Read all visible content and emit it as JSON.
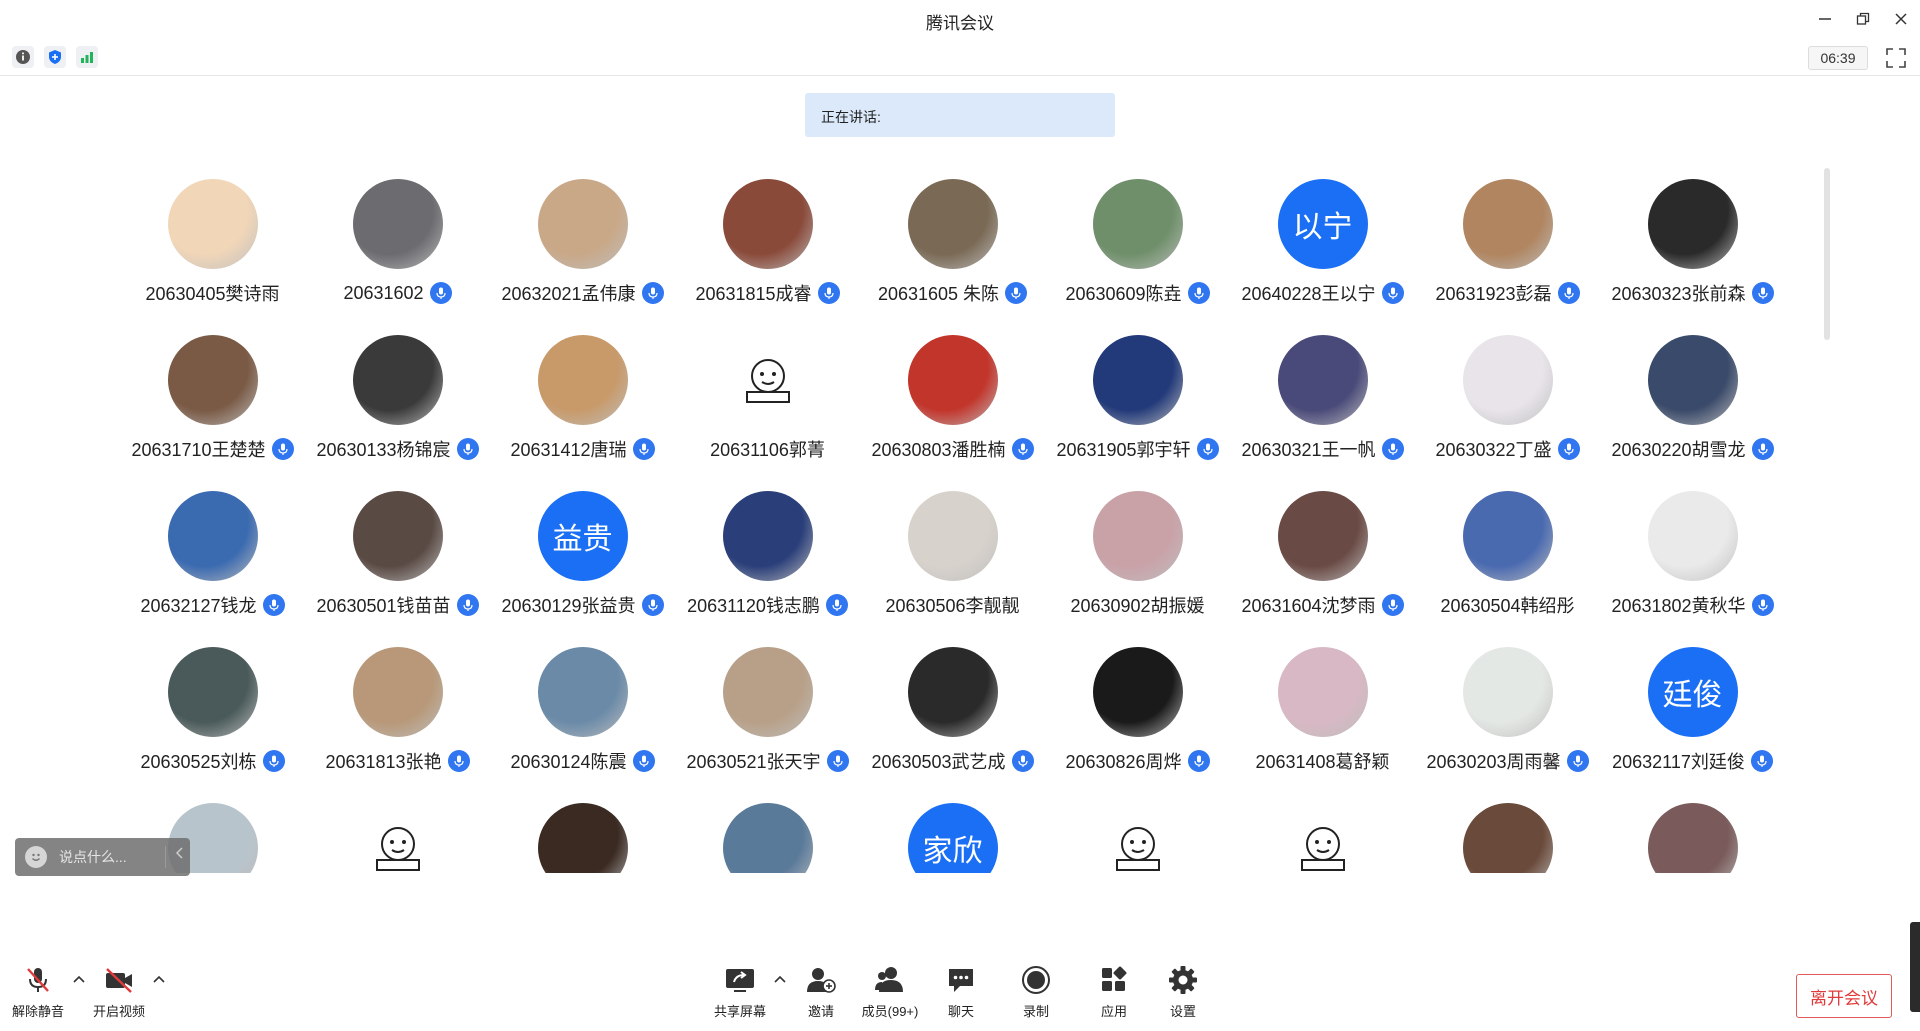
{
  "window": {
    "title": "腾讯会议"
  },
  "infobar": {
    "timer": "06:39"
  },
  "speaking": {
    "label": "正在讲话:"
  },
  "participants": [
    {
      "name": "20630405樊诗雨",
      "mic": false,
      "avatar": "photo",
      "color": "#f1d6b8"
    },
    {
      "name": "20631602",
      "mic": true,
      "avatar": "photo",
      "color": "#6b6b70"
    },
    {
      "name": "20632021孟伟康",
      "mic": true,
      "avatar": "photo",
      "color": "#c9a888"
    },
    {
      "name": "20631815成睿",
      "mic": true,
      "avatar": "photo",
      "color": "#8a4a3a"
    },
    {
      "name": "20631605 朱陈",
      "mic": true,
      "avatar": "photo",
      "color": "#7a6a55"
    },
    {
      "name": "20630609陈垚",
      "mic": true,
      "avatar": "photo",
      "color": "#6f8f6a"
    },
    {
      "name": "20640228王以宁",
      "mic": true,
      "avatar": "text",
      "text": "以宁"
    },
    {
      "name": "20631923彭磊",
      "mic": true,
      "avatar": "photo",
      "color": "#b08560"
    },
    {
      "name": "20630323张前森",
      "mic": true,
      "avatar": "photo",
      "color": "#2a2a2a"
    },
    {
      "name": "20631710王楚楚",
      "mic": true,
      "avatar": "photo",
      "color": "#7a5a45"
    },
    {
      "name": "20630133杨锦宸",
      "mic": true,
      "avatar": "photo",
      "color": "#3a3a3a"
    },
    {
      "name": "20631412唐瑞",
      "mic": true,
      "avatar": "photo",
      "color": "#c89a6a"
    },
    {
      "name": "20631106郭菁",
      "mic": false,
      "avatar": "sticker",
      "color": "#ffffff"
    },
    {
      "name": "20630803潘胜楠",
      "mic": true,
      "avatar": "photo",
      "color": "#c2352b"
    },
    {
      "name": "20631905郭宇轩",
      "mic": true,
      "avatar": "photo",
      "color": "#223a7a"
    },
    {
      "name": "20630321王一帆",
      "mic": true,
      "avatar": "photo",
      "color": "#4a4a7a"
    },
    {
      "name": "20630322丁盛",
      "mic": true,
      "avatar": "photo",
      "color": "#e8e4ea"
    },
    {
      "name": "20630220胡雪龙",
      "mic": true,
      "avatar": "photo",
      "color": "#3a4a6a"
    },
    {
      "name": "20632127钱龙",
      "mic": true,
      "avatar": "photo",
      "color": "#3a6ab0"
    },
    {
      "name": "20630501钱苗苗",
      "mic": true,
      "avatar": "photo",
      "color": "#5a4a44"
    },
    {
      "name": "20630129张益贵",
      "mic": true,
      "avatar": "text",
      "text": "益贵"
    },
    {
      "name": "20631120钱志鹏",
      "mic": true,
      "avatar": "photo",
      "color": "#2a3f7a"
    },
    {
      "name": "20630506李靓靓",
      "mic": false,
      "avatar": "photo",
      "color": "#d8d2cc"
    },
    {
      "name": "20630902胡振媛",
      "mic": false,
      "avatar": "photo",
      "color": "#c9a2a8"
    },
    {
      "name": "20631604沈梦雨",
      "mic": true,
      "avatar": "photo",
      "color": "#6a4a44"
    },
    {
      "name": "20630504韩绍彤",
      "mic": false,
      "avatar": "photo",
      "color": "#4a6ab0"
    },
    {
      "name": "20631802黄秋华",
      "mic": true,
      "avatar": "photo",
      "color": "#eaeaea"
    },
    {
      "name": "20630525刘栋",
      "mic": true,
      "avatar": "photo",
      "color": "#4a5a5a"
    },
    {
      "name": "20631813张艳",
      "mic": true,
      "avatar": "photo",
      "color": "#b89878"
    },
    {
      "name": "20630124陈震",
      "mic": true,
      "avatar": "photo",
      "color": "#6a8aa8"
    },
    {
      "name": "20630521张天宇",
      "mic": true,
      "avatar": "photo",
      "color": "#b8a088"
    },
    {
      "name": "20630503武艺成",
      "mic": true,
      "avatar": "photo",
      "color": "#2a2a2a"
    },
    {
      "name": "20630826周烨",
      "mic": true,
      "avatar": "photo",
      "color": "#1a1a1a"
    },
    {
      "name": "20631408葛舒颖",
      "mic": false,
      "avatar": "photo",
      "color": "#d8b8c4"
    },
    {
      "name": "20630203周雨馨",
      "mic": true,
      "avatar": "photo",
      "color": "#e4e8e4"
    },
    {
      "name": "20632117刘廷俊",
      "mic": true,
      "avatar": "text",
      "text": "廷俊"
    },
    {
      "name": "",
      "mic": false,
      "avatar": "photo",
      "color": "#b8c4cc"
    },
    {
      "name": "",
      "mic": false,
      "avatar": "sticker",
      "color": "#ffffff"
    },
    {
      "name": "",
      "mic": false,
      "avatar": "photo",
      "color": "#3a2a22"
    },
    {
      "name": "",
      "mic": false,
      "avatar": "photo",
      "color": "#5a7a9a"
    },
    {
      "name": "",
      "mic": false,
      "avatar": "text",
      "text": "家欣"
    },
    {
      "name": "",
      "mic": false,
      "avatar": "sticker",
      "color": "#ffffff"
    },
    {
      "name": "",
      "mic": false,
      "avatar": "sticker",
      "color": "#ffffff"
    },
    {
      "name": "",
      "mic": false,
      "avatar": "photo",
      "color": "#6a4a3a"
    },
    {
      "name": "",
      "mic": false,
      "avatar": "photo",
      "color": "#7a5a5a"
    }
  ],
  "chat": {
    "placeholder": "说点什么..."
  },
  "toolbar": {
    "unmute": "解除静音",
    "start_video": "开启视频",
    "share_screen": "共享屏幕",
    "invite": "邀请",
    "members": "成员(99+)",
    "chat": "聊天",
    "record": "录制",
    "apps": "应用",
    "settings": "设置",
    "leave": "离开会议"
  },
  "colors": {
    "accent": "#1a6ff5",
    "leave": "#e03a3a",
    "speaking_bg": "#dbe9fb"
  }
}
